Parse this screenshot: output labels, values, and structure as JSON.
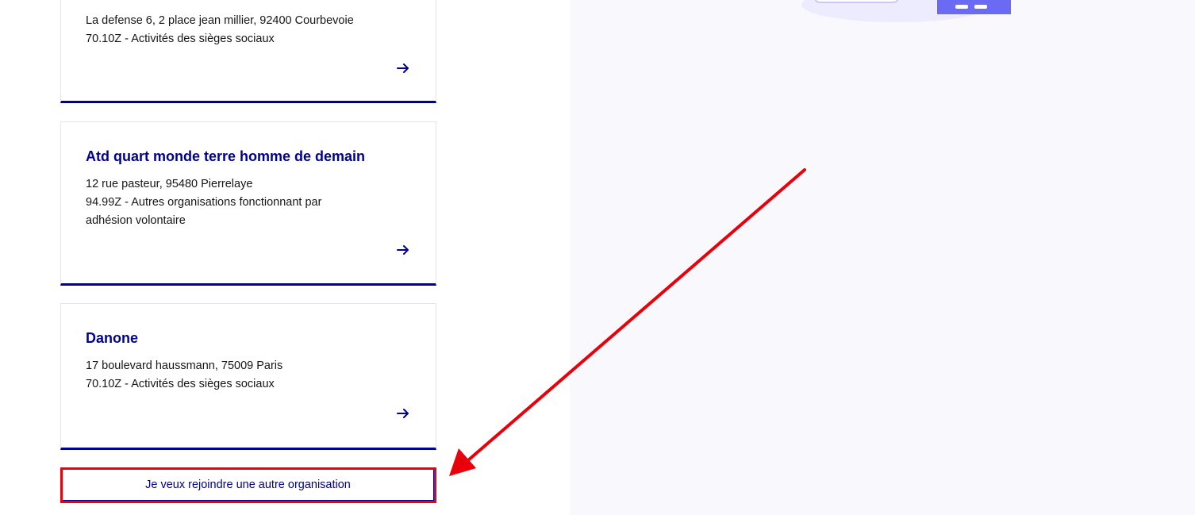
{
  "cards": [
    {
      "title": "",
      "address": "La defense 6, 2 place jean millier, 92400 Courbevoie",
      "activity_line1": "70.10Z - Activités des sièges sociaux",
      "activity_line2": ""
    },
    {
      "title": "Atd quart monde terre homme de demain",
      "address": "12 rue pasteur, 95480 Pierrelaye",
      "activity_line1": "94.99Z - Autres organisations fonctionnant par",
      "activity_line2": "adhésion volontaire"
    },
    {
      "title": "Danone",
      "address": "17 boulevard haussmann, 75009 Paris",
      "activity_line1": "70.10Z - Activités des sièges sociaux",
      "activity_line2": ""
    }
  ],
  "join_button_label": "Je veux rejoindre une autre organisation",
  "icons": {
    "card_arrow": "arrow-right-icon",
    "annotation": "red-pointer-arrow"
  },
  "colors": {
    "primary": "#000091",
    "annotation": "#e8000b",
    "right_pane_bg": "#f8f8fd"
  }
}
